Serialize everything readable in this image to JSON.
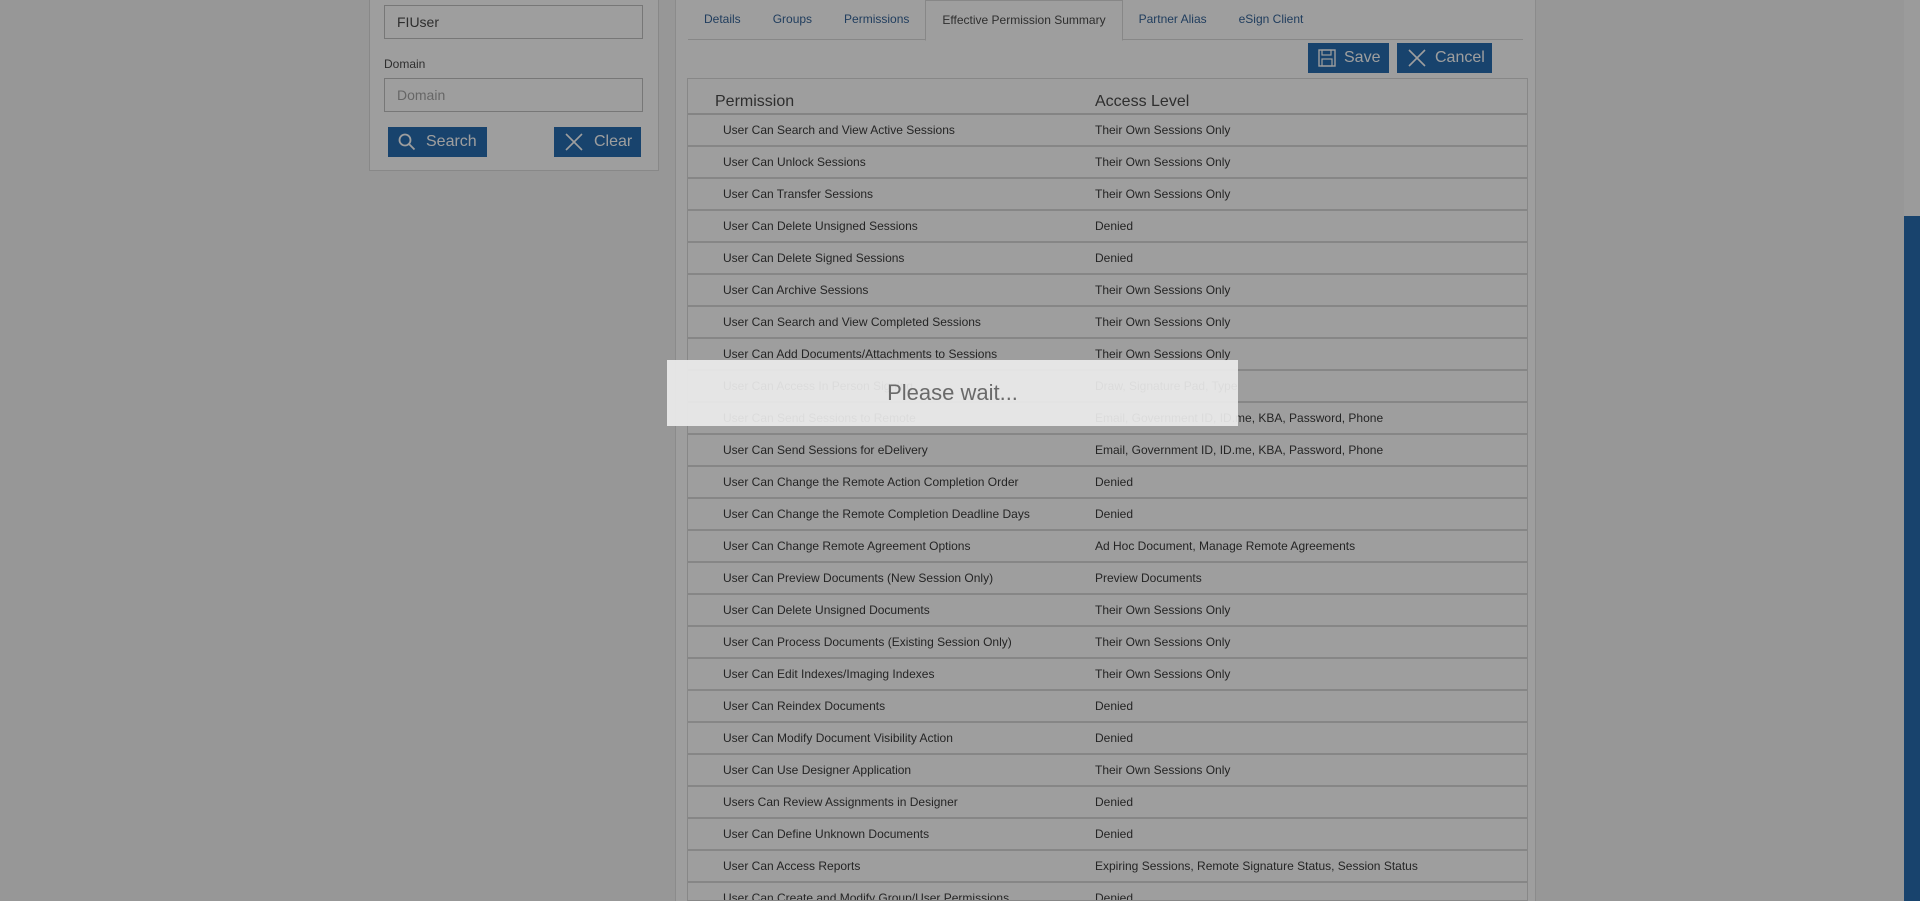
{
  "search_panel": {
    "user_input_value": "FIUser",
    "domain_label": "Domain",
    "domain_placeholder": "Domain",
    "search_button": "Search",
    "clear_button": "Clear"
  },
  "tabs": [
    {
      "label": "Details",
      "active": false
    },
    {
      "label": "Groups",
      "active": false
    },
    {
      "label": "Permissions",
      "active": false
    },
    {
      "label": "Effective Permission Summary",
      "active": true
    },
    {
      "label": "Partner Alias",
      "active": false
    },
    {
      "label": "eSign Client",
      "active": false
    }
  ],
  "actions": {
    "save": "Save",
    "cancel": "Cancel"
  },
  "table": {
    "headers": {
      "permission": "Permission",
      "access": "Access Level"
    },
    "rows": [
      {
        "permission": "User Can Search and View Active Sessions",
        "access": "Their Own Sessions Only"
      },
      {
        "permission": "User Can Unlock Sessions",
        "access": "Their Own Sessions Only"
      },
      {
        "permission": "User Can Transfer Sessions",
        "access": "Their Own Sessions Only"
      },
      {
        "permission": "User Can Delete Unsigned Sessions",
        "access": "Denied"
      },
      {
        "permission": "User Can Delete Signed Sessions",
        "access": "Denied"
      },
      {
        "permission": "User Can Archive Sessions",
        "access": "Their Own Sessions Only"
      },
      {
        "permission": "User Can Search and View Completed Sessions",
        "access": "Their Own Sessions Only"
      },
      {
        "permission": "User Can Add Documents/Attachments to Sessions",
        "access": "Their Own Sessions Only"
      },
      {
        "permission": "User Can Access In Person Signing",
        "access": "Draw, Signature Pad, Type"
      },
      {
        "permission": "User Can Send Sessions to Remote",
        "access": "Email, Government ID, ID.me, KBA, Password, Phone"
      },
      {
        "permission": "User Can Send Sessions for eDelivery",
        "access": "Email, Government ID, ID.me, KBA, Password, Phone"
      },
      {
        "permission": "User Can Change the Remote Action Completion Order",
        "access": "Denied"
      },
      {
        "permission": "User Can Change the Remote Completion Deadline Days",
        "access": "Denied"
      },
      {
        "permission": "User Can Change Remote Agreement Options",
        "access": "Ad Hoc Document, Manage Remote Agreements"
      },
      {
        "permission": "User Can Preview Documents (New Session Only)",
        "access": "Preview Documents"
      },
      {
        "permission": "User Can Delete Unsigned Documents",
        "access": "Their Own Sessions Only"
      },
      {
        "permission": "User Can Process Documents (Existing Session Only)",
        "access": "Their Own Sessions Only"
      },
      {
        "permission": "User Can Edit Indexes/Imaging Indexes",
        "access": "Their Own Sessions Only"
      },
      {
        "permission": "User Can Reindex Documents",
        "access": "Denied"
      },
      {
        "permission": "User Can Modify Document Visibility Action",
        "access": "Denied"
      },
      {
        "permission": "User Can Use Designer Application",
        "access": "Their Own Sessions Only"
      },
      {
        "permission": "Users Can Review Assignments in Designer",
        "access": "Denied"
      },
      {
        "permission": "User Can Define Unknown Documents",
        "access": "Denied"
      },
      {
        "permission": "User Can Access Reports",
        "access": "Expiring Sessions, Remote Signature Status, Session Status"
      },
      {
        "permission": "User Can Create and Modify Group/User Permissions",
        "access": "Denied"
      }
    ]
  },
  "modal": {
    "message": "Please wait..."
  },
  "colors": {
    "accent": "#0b5aa6",
    "tab_link": "#1a4f8a"
  }
}
